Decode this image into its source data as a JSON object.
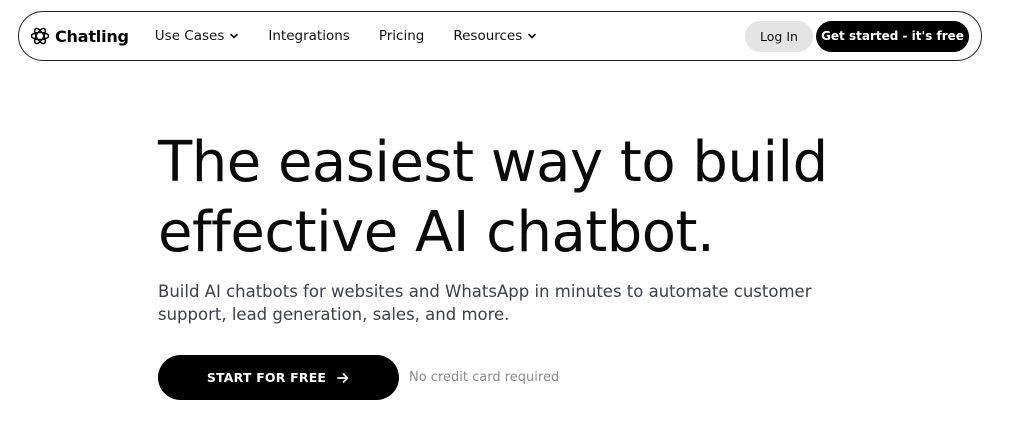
{
  "nav": {
    "brand": "Chatling",
    "brand_icon": "atom-logo-icon",
    "items": [
      {
        "label": "Use Cases",
        "has_dropdown": true
      },
      {
        "label": "Integrations",
        "has_dropdown": false
      },
      {
        "label": "Pricing",
        "has_dropdown": false
      },
      {
        "label": "Resources",
        "has_dropdown": true
      }
    ],
    "login_label": "Log In",
    "cta_label": "Get started - it's free"
  },
  "hero": {
    "title_line1": "The easiest way to build",
    "title_line2": "effective AI chatbot.",
    "subtitle": "Build AI chatbots for websites and WhatsApp in minutes to automate customer support, lead generation, sales, and more.",
    "cta_label": "START FOR FREE",
    "cta_icon": "arrow-right-icon",
    "note": "No credit card required"
  },
  "colors": {
    "background": "#ffffff",
    "primary": "#000000",
    "login_bg": "#e4e4e4",
    "subtitle_text": "#3d3f4a",
    "note_text": "#8a8c94"
  }
}
